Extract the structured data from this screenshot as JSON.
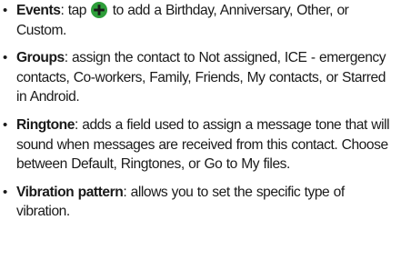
{
  "items": [
    {
      "term": "Events",
      "text_before_icon": ": tap ",
      "icon": "green-plus-icon",
      "text_after_icon": " to add a Birthday, Anniversary, Other, or Custom."
    },
    {
      "term": "Groups",
      "text": ": assign the contact to Not assigned, ICE - emergency contacts, Co-workers, Family, Friends, My contacts, or Starred in Android."
    },
    {
      "term": "Ringtone",
      "text": ": adds a field used to assign a message tone that will sound when messages are received from this contact. Choose between Default, Ringtones, or Go to My files."
    },
    {
      "term": "Vibration pattern",
      "text": ": allows you to set the specific type of vibration."
    }
  ],
  "bullet_char": "•",
  "colors": {
    "text": "#1a1a1a",
    "icon_fill": "#2e9e3a",
    "icon_plus": "#1a1a1a"
  }
}
